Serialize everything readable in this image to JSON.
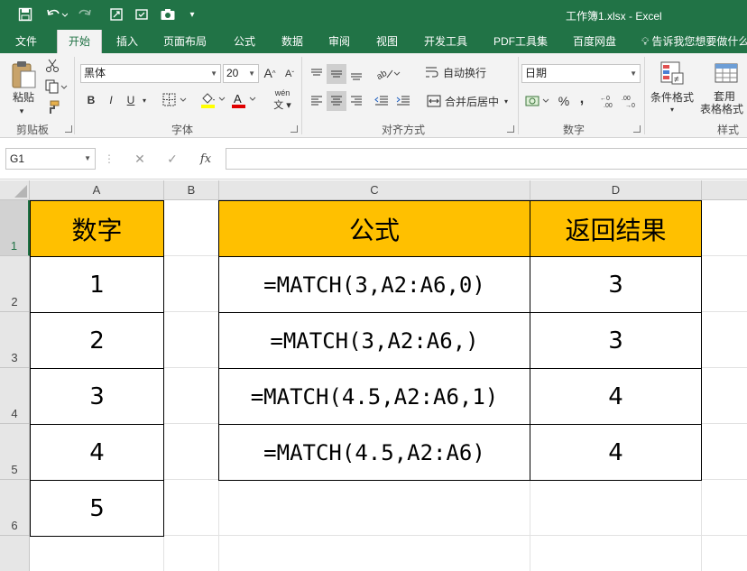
{
  "titlebar": {
    "title": "工作簿1.xlsx - Excel"
  },
  "tabs": [
    {
      "label": "文件"
    },
    {
      "label": "开始"
    },
    {
      "label": "插入"
    },
    {
      "label": "页面布局"
    },
    {
      "label": "公式"
    },
    {
      "label": "数据"
    },
    {
      "label": "审阅"
    },
    {
      "label": "视图"
    },
    {
      "label": "开发工具"
    },
    {
      "label": "PDF工具集"
    },
    {
      "label": "百度网盘"
    }
  ],
  "tell_me": "告诉我您想要做什么",
  "ribbon": {
    "clipboard": {
      "paste_label": "粘贴",
      "group_label": "剪贴板"
    },
    "font": {
      "font_name": "黑体",
      "font_size": "20",
      "group_label": "字体",
      "bold": "B",
      "italic": "I",
      "underline": "U",
      "grow": "A",
      "shrink": "A",
      "phonetic": "wén"
    },
    "alignment": {
      "wrap_text": "自动换行",
      "merge_center": "合并后居中",
      "group_label": "对齐方式"
    },
    "number": {
      "format": "日期",
      "percent": "%",
      "comma": ",",
      "group_label": "数字"
    },
    "styles": {
      "conditional": "条件格式",
      "table_line1": "套用",
      "table_line2": "表格格式",
      "group_label": "样式"
    }
  },
  "formula_bar": {
    "name_box": "G1",
    "cancel": "✕",
    "enter": "✓",
    "fx": "fx",
    "content": ""
  },
  "columns": [
    "A",
    "B",
    "C",
    "D"
  ],
  "rows": [
    "1",
    "2",
    "3",
    "4",
    "5",
    "6"
  ],
  "selected_row": "1",
  "cells": {
    "A1": "数字",
    "A2": "1",
    "A3": "2",
    "A4": "3",
    "A5": "4",
    "A6": "5",
    "C1": "公式",
    "D1": "返回结果",
    "C2": "=MATCH(3,A2:A6,0)",
    "D2": "3",
    "C3": "=MATCH(3,A2:A6,)",
    "D3": "3",
    "C4": "=MATCH(4.5,A2:A6,1)",
    "D4": "4",
    "C5": "=MATCH(4.5,A2:A6)",
    "D5": "4"
  },
  "colors": {
    "excel_green": "#217346",
    "header_fill": "#ffc000"
  }
}
